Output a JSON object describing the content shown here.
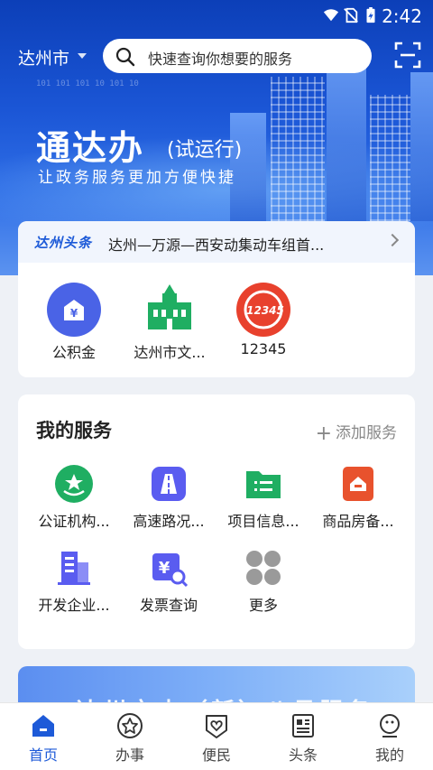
{
  "status": {
    "time": "2:42"
  },
  "header": {
    "city": "达州市",
    "search_placeholder": "快速查询你想要的服务",
    "slogan_main": "通达办",
    "slogan_tag": "(试运行)",
    "slogan_sub": "让政务服务更加方便快捷",
    "code_text": "101 101 101 10 101 10"
  },
  "news": {
    "source_logo": "达州头条",
    "headline": "达州—万源—西安动集动车组首..."
  },
  "quick_apps": [
    {
      "label": "公积金",
      "icon": "provident-fund-icon",
      "color": "#4a63e6"
    },
    {
      "label": "达州市文...",
      "icon": "building-icon",
      "color": "#1fae62"
    },
    {
      "label": "12345",
      "icon": "hotline-12345-icon",
      "color": "#e8412d"
    }
  ],
  "my_services": {
    "title": "我的服务",
    "add_label": "添加服务",
    "items": [
      {
        "label": "公证机构...",
        "icon": "notary-icon",
        "color": "#1fae62"
      },
      {
        "label": "高速路况...",
        "icon": "highway-icon",
        "color": "#5a5cf0"
      },
      {
        "label": "项目信息...",
        "icon": "folder-list-icon",
        "color": "#1fae62"
      },
      {
        "label": "商品房备...",
        "icon": "house-icon",
        "color": "#e8522d"
      },
      {
        "label": "开发企业...",
        "icon": "company-icon",
        "color": "#5a5cf0"
      },
      {
        "label": "发票查询",
        "icon": "invoice-search-icon",
        "color": "#5a5cf0"
      },
      {
        "label": "更多",
        "icon": "more-icon",
        "color": "#9a9a9a"
      }
    ]
  },
  "promo": {
    "text": "达州市志（新）八月服务"
  },
  "bottom_nav": [
    {
      "label": "首页",
      "icon": "home-icon",
      "active": true
    },
    {
      "label": "办事",
      "icon": "star-icon",
      "active": false
    },
    {
      "label": "便民",
      "icon": "heart-shield-icon",
      "active": false
    },
    {
      "label": "头条",
      "icon": "news-icon",
      "active": false
    },
    {
      "label": "我的",
      "icon": "profile-icon",
      "active": false
    }
  ],
  "colors": {
    "primary": "#1d5ad8",
    "banner_dark": "#0c3fb8"
  }
}
